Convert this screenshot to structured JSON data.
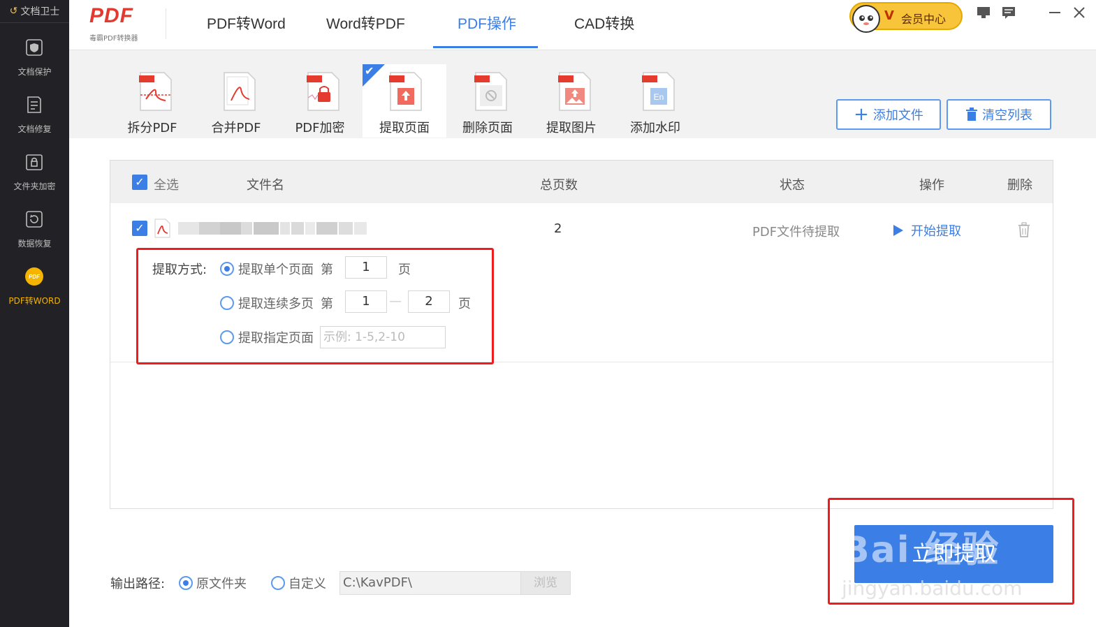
{
  "sidebar": {
    "app_title": "文档卫士",
    "items": [
      {
        "label": "文档保护",
        "icon": "shield-icon"
      },
      {
        "label": "文档修复",
        "icon": "document-edit-icon"
      },
      {
        "label": "文件夹加密",
        "icon": "lock-folder-icon"
      },
      {
        "label": "数据恢复",
        "icon": "restore-icon"
      },
      {
        "label": "PDF转WORD",
        "icon": "pdf-badge-icon",
        "active": true
      }
    ]
  },
  "header": {
    "logo_text": "PDF",
    "logo_subtitle": "毒霸PDF转换器",
    "tabs": [
      {
        "label": "PDF转Word"
      },
      {
        "label": "Word转PDF"
      },
      {
        "label": "PDF操作",
        "active": true
      },
      {
        "label": "CAD转换"
      }
    ],
    "vip_label": "会员中心",
    "vip_mark": "V"
  },
  "tools": [
    {
      "label": "拆分PDF"
    },
    {
      "label": "合并PDF"
    },
    {
      "label": "PDF加密"
    },
    {
      "label": "提取页面",
      "active": true
    },
    {
      "label": "删除页面"
    },
    {
      "label": "提取图片"
    },
    {
      "label": "添加水印"
    }
  ],
  "actions": {
    "add_file": "添加文件",
    "clear_list": "清空列表"
  },
  "table": {
    "headers": {
      "select_all": "全选",
      "filename": "文件名",
      "total_pages": "总页数",
      "status": "状态",
      "operation": "操作",
      "delete": "删除"
    },
    "rows": [
      {
        "pages": "2",
        "status": "PDF文件待提取",
        "action": "开始提取"
      }
    ]
  },
  "extract": {
    "mode_label": "提取方式:",
    "single": {
      "label": "提取单个页面",
      "prefix": "第",
      "value": "1",
      "suffix": "页"
    },
    "range": {
      "label": "提取连续多页",
      "prefix": "第",
      "from": "1",
      "dash": "—",
      "to": "2",
      "suffix": "页"
    },
    "custom": {
      "label": "提取指定页面",
      "placeholder": "示例: 1-5,2-10"
    }
  },
  "output": {
    "label": "输出路径:",
    "original": "原文件夹",
    "custom": "自定义",
    "path": "C:\\KavPDF\\",
    "browse": "浏览"
  },
  "submit_label": "立即提取",
  "watermark": {
    "line1": "Bai 经验",
    "line2": "jingyan.baidu.com"
  },
  "colors": {
    "accent": "#3a7ee6",
    "highlight_box": "#ee1c1c",
    "sidebar_bg": "#222226",
    "vip_gold": "#f7c43a"
  }
}
